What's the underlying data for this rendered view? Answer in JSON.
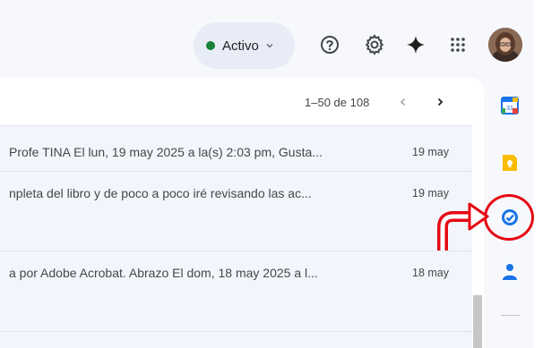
{
  "header": {
    "status": {
      "label": "Activo",
      "color": "#188038"
    },
    "icons": [
      "help-icon",
      "settings-icon",
      "gemini-sparkle-icon",
      "apps-grid-icon"
    ],
    "avatar": "avatar"
  },
  "pager": {
    "range": "1–50 de 108",
    "prev": "chevron-left-icon",
    "next": "chevron-right-icon"
  },
  "emails": [
    {
      "snippet": "Profe TINA El lun, 19 may 2025 a la(s) 2:03 pm, Gusta...",
      "date": "19 may"
    },
    {
      "snippet": "npleta del libro y de poco a poco iré revisando las ac...",
      "date": "19 may"
    },
    {
      "snippet": "a por Adobe Acrobat. Abrazo El dom, 18 may 2025 a l...",
      "date": "18 may"
    }
  ],
  "side_panel": {
    "items": [
      "calendar-icon",
      "keep-icon",
      "tasks-icon",
      "contacts-icon"
    ],
    "calendar_day": "31"
  },
  "colors": {
    "annotation": "#e50914",
    "tasks": "#1a73e8",
    "keep": "#fbbc04"
  }
}
